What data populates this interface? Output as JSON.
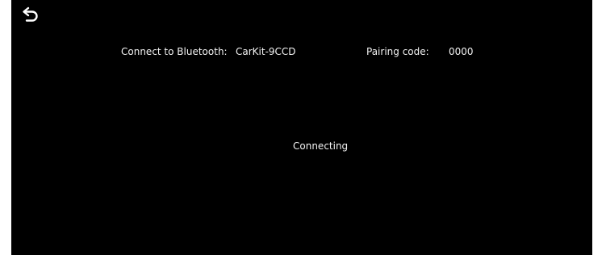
{
  "header": {
    "back_icon": "back-arrow-icon"
  },
  "bluetooth": {
    "connect_label": "Connect to Bluetooth:",
    "device_name": "CarKit-9CCD",
    "pairing_label": "Pairing code:",
    "pairing_code": "0000"
  },
  "status": {
    "text": "Connecting"
  },
  "colors": {
    "background": "#000000",
    "text": "#f2f2f2"
  }
}
